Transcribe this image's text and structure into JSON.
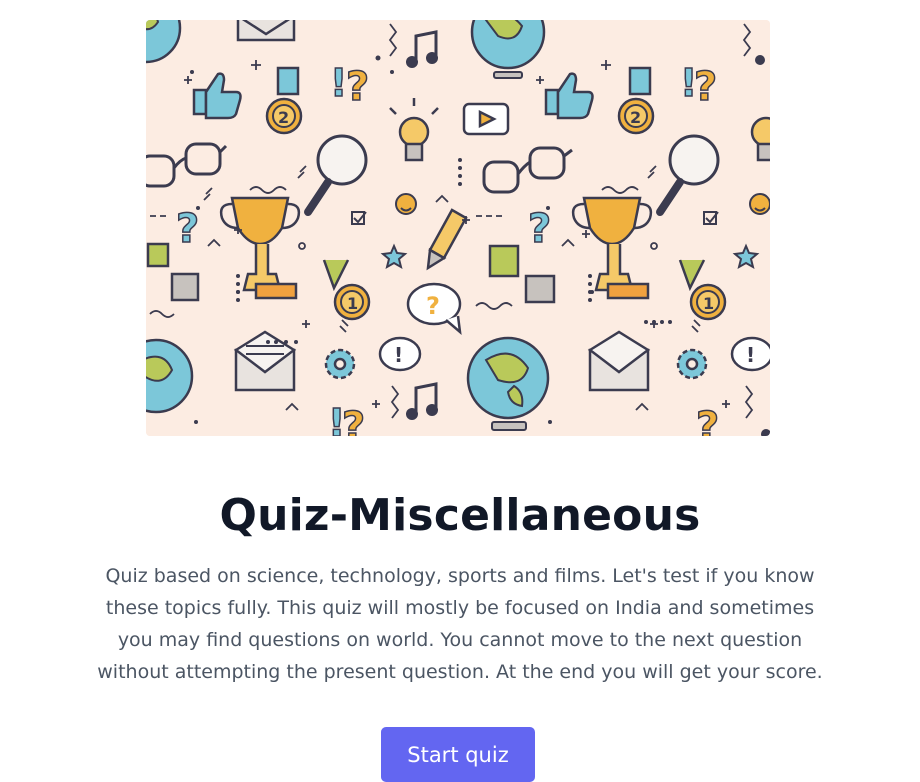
{
  "hero": {
    "question_glyph": "?",
    "exclaim_glyph": "!",
    "medal_first": "1",
    "medal_second": "2"
  },
  "quiz": {
    "title": "Quiz-Miscellaneous",
    "description": "Quiz based on science, technology, sports and films. Let's test if you know these topics fully. This quiz will mostly be focused on India and sometimes you may find questions on world. You cannot move to the next question without attempting the present question. At the end you will get your score.",
    "start_label": "Start quiz"
  },
  "colors": {
    "accent": "#6366f1",
    "hero_background": "#fcece2",
    "title": "#111827",
    "body_text": "#4b5563"
  }
}
